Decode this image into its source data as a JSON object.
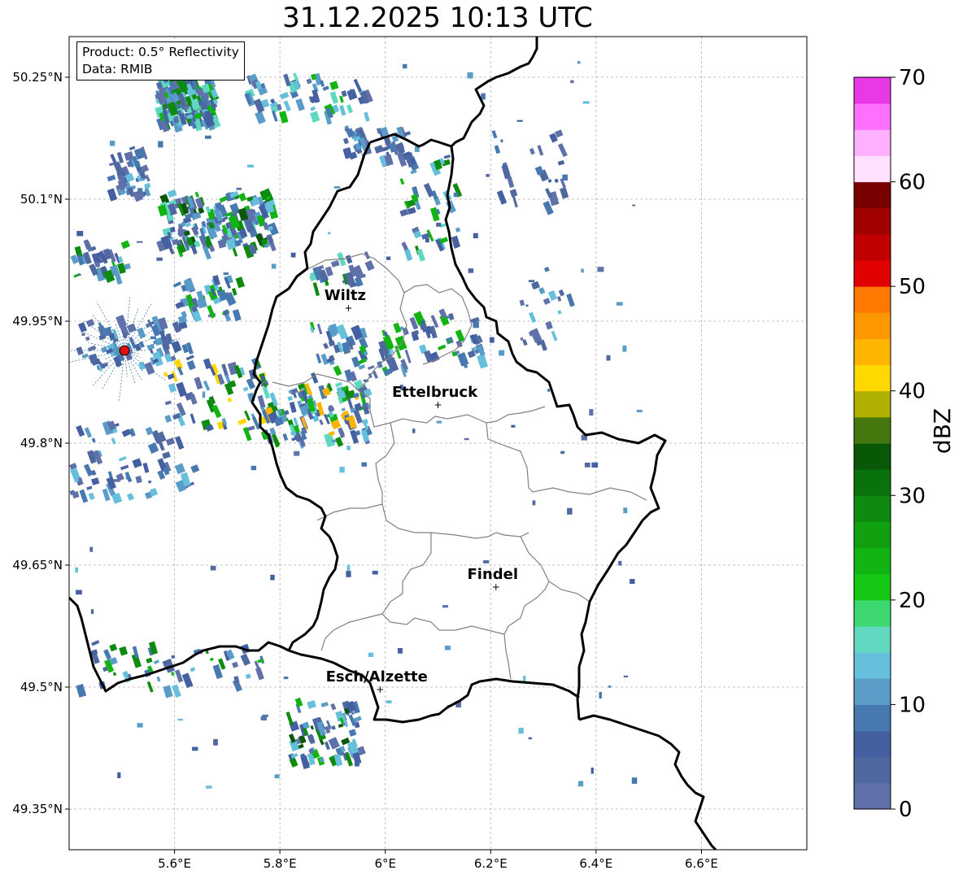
{
  "title": "31.12.2025 10:13 UTC",
  "info": {
    "product": "Product: 0.5° Reflectivity",
    "data_source": "Data: RMIB"
  },
  "map": {
    "lon_range": [
      5.4,
      6.8
    ],
    "lat_range": [
      49.3,
      50.3
    ],
    "lon_ticks": [
      {
        "value": 5.6,
        "label": "5.6°E"
      },
      {
        "value": 5.8,
        "label": "5.8°E"
      },
      {
        "value": 6.0,
        "label": "6°E"
      },
      {
        "value": 6.2,
        "label": "6.2°E"
      },
      {
        "value": 6.4,
        "label": "6.4°E"
      },
      {
        "value": 6.6,
        "label": "6.6°E"
      }
    ],
    "lat_ticks": [
      {
        "value": 50.25,
        "label": "50.25°N"
      },
      {
        "value": 50.1,
        "label": "50.1°N"
      },
      {
        "value": 49.95,
        "label": "49.95°N"
      },
      {
        "value": 49.8,
        "label": "49.8°N"
      },
      {
        "value": 49.65,
        "label": "49.65°N"
      },
      {
        "value": 49.5,
        "label": "49.5°N"
      },
      {
        "value": 49.35,
        "label": "49.35°N"
      }
    ],
    "grid": true,
    "cities": [
      {
        "name": "Wiltz",
        "lon": 5.93,
        "lat": 49.966
      },
      {
        "name": "Ettelbruck",
        "lon": 6.1,
        "lat": 49.847
      },
      {
        "name": "Findel",
        "lon": 6.21,
        "lat": 49.623
      },
      {
        "name": "Esch/Alzette",
        "lon": 5.99,
        "lat": 49.497
      }
    ],
    "radar_site": {
      "lon": 5.505,
      "lat": 49.914,
      "color": "#e01010"
    }
  },
  "colorbar": {
    "label": "dBZ",
    "min": 0,
    "max": 70,
    "tick_values": [
      0,
      10,
      20,
      30,
      40,
      50,
      60,
      70
    ],
    "tick_labels": [
      "0",
      "10",
      "20",
      "30",
      "40",
      "50",
      "60",
      "70"
    ],
    "colors": [
      "#6070a8",
      "#5068a0",
      "#4560a0",
      "#4878b0",
      "#5a9cc8",
      "#66c0dc",
      "#60d8c0",
      "#3ed870",
      "#14c814",
      "#12b414",
      "#10a010",
      "#0e8a0e",
      "#0a720a",
      "#085808",
      "#467810",
      "#b0b000",
      "#ffd800",
      "#ffb400",
      "#ff9800",
      "#ff7800",
      "#e00000",
      "#c00000",
      "#a00000",
      "#780000",
      "#ffe0ff",
      "#ffb0ff",
      "#ff70ff",
      "#e838e8"
    ]
  }
}
